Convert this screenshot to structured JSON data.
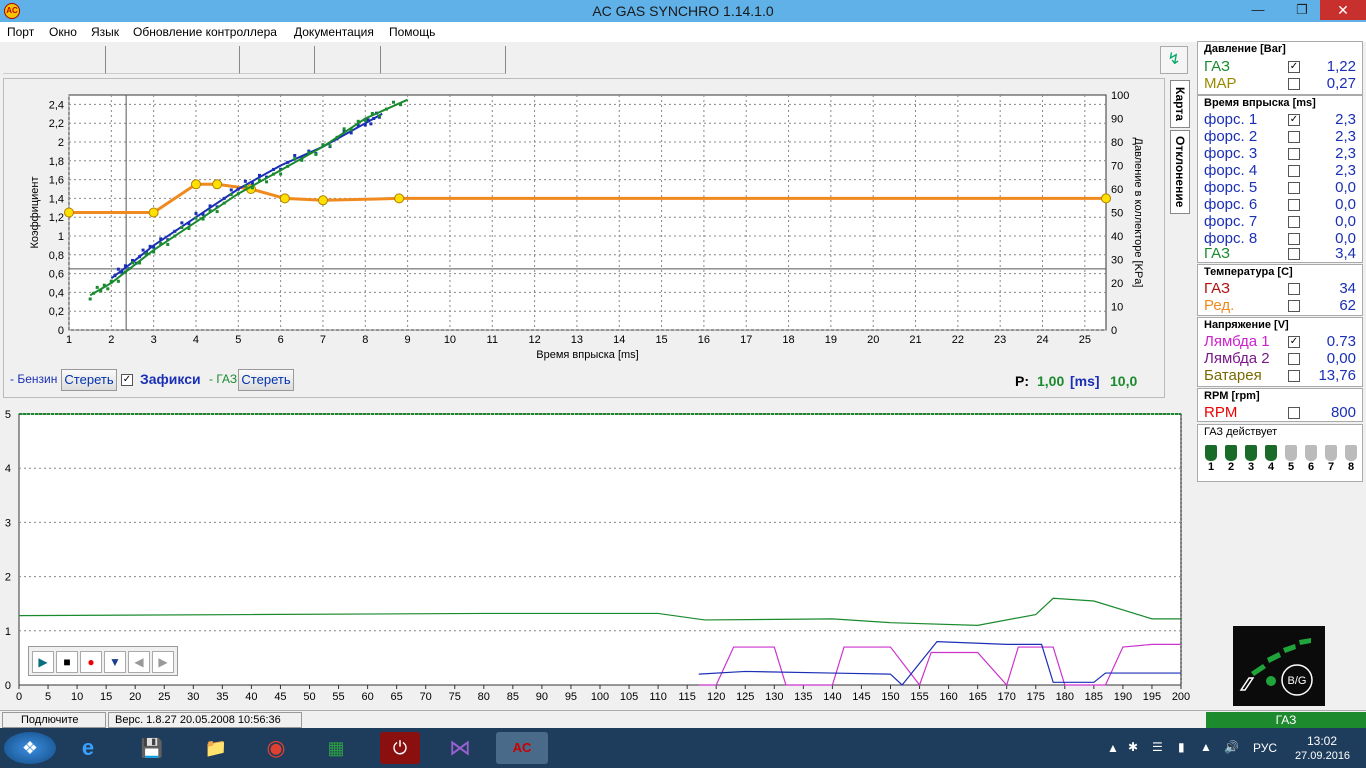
{
  "window": {
    "title": "AC GAS SYNCHRO   1.14.1.0",
    "app_icon": "AC"
  },
  "menu": [
    "Порт",
    "Окно",
    "Язык",
    "Обновление контроллера",
    "Документация",
    "Помощь"
  ],
  "map_chart": {
    "left_axis_label": "Коэффициент",
    "right_axis_label": "Давление в коллекторе [KPa]",
    "x_axis_label": "Время впрыска [ms]",
    "tabs": [
      "Карта",
      "Отклонение"
    ]
  },
  "map_controls": {
    "benzin_label": "- Бензин",
    "clear1": "Стереть",
    "fix_label": "Зафикси",
    "fix_checked": "✓",
    "gas_label": "- ГАЗ",
    "clear2": "Стереть",
    "p_label": "P:",
    "p_value": "1,00",
    "p_unit": "[ms]",
    "p_value2": "10,0"
  },
  "chart_data": [
    {
      "type": "line",
      "title": "",
      "xlabel": "Время впрыска [ms]",
      "ylabel": "Коэффициент",
      "y2label": "Давление в коллекторе [KPa]",
      "xlim": [
        1,
        25.5
      ],
      "ylim": [
        0,
        2.5
      ],
      "y2lim": [
        0,
        100
      ],
      "x_ticks": [
        1,
        2,
        3,
        4,
        5,
        6,
        7,
        8,
        9,
        10,
        11,
        12,
        13,
        14,
        15,
        16,
        17,
        18,
        19,
        20,
        21,
        22,
        23,
        24,
        25
      ],
      "y_ticks": [
        "0",
        "0,2",
        "0,4",
        "0,6",
        "0,8",
        "1",
        "1,2",
        "1,4",
        "1,6",
        "1,8",
        "2",
        "2,2",
        "2,4"
      ],
      "y2_ticks": [
        0,
        10,
        20,
        30,
        40,
        50,
        60,
        70,
        80,
        90,
        100
      ],
      "grid": true,
      "cursor_x": 2.35,
      "cursor_y": 0.65,
      "series": [
        {
          "color": "#f08a1e",
          "x": [
            1,
            3,
            4,
            4.5,
            5.3,
            6.1,
            7,
            8.8,
            25.5
          ],
          "y": [
            1.25,
            1.25,
            1.55,
            1.55,
            1.5,
            1.4,
            1.38,
            1.4,
            1.4
          ]
        },
        {
          "color": "#1a2fb5",
          "x": [
            2,
            2.5,
            3,
            4,
            5,
            6,
            7,
            8,
            8.4
          ],
          "y": [
            0.55,
            0.72,
            0.9,
            1.2,
            1.5,
            1.75,
            1.95,
            2.2,
            2.3
          ]
        },
        {
          "color": "#1a8a2e",
          "x": [
            1.5,
            2,
            3,
            4,
            5,
            6,
            7,
            8,
            9
          ],
          "y": [
            0.37,
            0.5,
            0.85,
            1.15,
            1.45,
            1.7,
            1.95,
            2.25,
            2.45
          ]
        }
      ]
    },
    {
      "type": "line",
      "title": "",
      "xlim": [
        0,
        200
      ],
      "ylim": [
        0,
        5
      ],
      "x_ticks": [
        0,
        5,
        10,
        15,
        20,
        25,
        30,
        35,
        40,
        45,
        50,
        55,
        60,
        65,
        70,
        75,
        80,
        85,
        90,
        95,
        100,
        105,
        110,
        115,
        120,
        125,
        130,
        135,
        140,
        145,
        150,
        155,
        160,
        165,
        170,
        175,
        180,
        185,
        190,
        195,
        200
      ],
      "y_ticks": [
        0,
        1,
        2,
        3,
        4,
        5
      ],
      "grid": true,
      "series": [
        {
          "color": "#1a8a2e",
          "x": [
            0,
            40,
            80,
            110,
            118,
            140,
            150,
            165,
            175,
            178,
            185,
            195,
            200
          ],
          "y": [
            1.28,
            1.3,
            1.32,
            1.32,
            1.2,
            1.22,
            1.15,
            1.1,
            1.3,
            1.6,
            1.55,
            1.22,
            1.22
          ]
        },
        {
          "color": "#cc33cc",
          "x": [
            117,
            120,
            123,
            130,
            132,
            140,
            142,
            150,
            155,
            157,
            165,
            170,
            172,
            178,
            180,
            187,
            190,
            195,
            200
          ],
          "y": [
            0,
            0,
            0.7,
            0.7,
            0,
            0,
            0.7,
            0.7,
            0,
            0.6,
            0.6,
            0,
            0.7,
            0.7,
            0,
            0,
            0.7,
            0.75,
            0.75
          ]
        },
        {
          "color": "#1a2fb5",
          "x": [
            117,
            125,
            140,
            150,
            152,
            158,
            170,
            176,
            178,
            185,
            187,
            200
          ],
          "y": [
            0.2,
            0.25,
            0.22,
            0.2,
            0,
            0.8,
            0.75,
            0.75,
            0.05,
            0.05,
            0.22,
            0.22
          ]
        }
      ]
    }
  ],
  "pressure": {
    "title": "Давление [Bar]",
    "gas_label": "ГАЗ",
    "gas_check": "✓",
    "gas_value": "1,22",
    "map_label": "MAP",
    "map_value": "0,27"
  },
  "injection": {
    "title": "Время впрыска [ms]",
    "rows": [
      {
        "label": "форс. 1",
        "check": "✓",
        "value": "2,3"
      },
      {
        "label": "форс. 2",
        "value": "2,3"
      },
      {
        "label": "форс. 3",
        "value": "2,3"
      },
      {
        "label": "форс. 4",
        "value": "2,3"
      },
      {
        "label": "форс. 5",
        "value": "0,0"
      },
      {
        "label": "форс. 6",
        "value": "0,0"
      },
      {
        "label": "форс. 7",
        "value": "0,0"
      },
      {
        "label": "форс. 8",
        "value": "0,0"
      }
    ],
    "gas_label": "ГАЗ",
    "gas_value": "3,4"
  },
  "temperature": {
    "title": "Температура  [C]",
    "gas_label": "ГАЗ",
    "gas_value": "34",
    "red_label": "Ред.",
    "red_value": "62"
  },
  "voltage": {
    "title": "Напряжение [V]",
    "l1_label": "Лямбда 1",
    "l1_check": "✓",
    "l1_value": "0.73",
    "l2_label": "Лямбда 2",
    "l2_value": "0,00",
    "bat_label": "Батарея",
    "bat_value": "13,76"
  },
  "rpm": {
    "title": "RPM [rpm]",
    "label": "RPM",
    "value": "800"
  },
  "gas_active": {
    "title": "ГАЗ действует",
    "injectors": [
      "1",
      "2",
      "3",
      "4",
      "5",
      "6",
      "7",
      "8"
    ],
    "active_count": 4
  },
  "logo": {
    "text": "B/G"
  },
  "status": {
    "connect": "Подлючите",
    "version": "Верс. 1.8.27  20.05.2008  10:56:36",
    "gas": "ГАЗ"
  },
  "tray": {
    "lang": "РУС",
    "time": "13:02",
    "date": "27.09.2016"
  }
}
